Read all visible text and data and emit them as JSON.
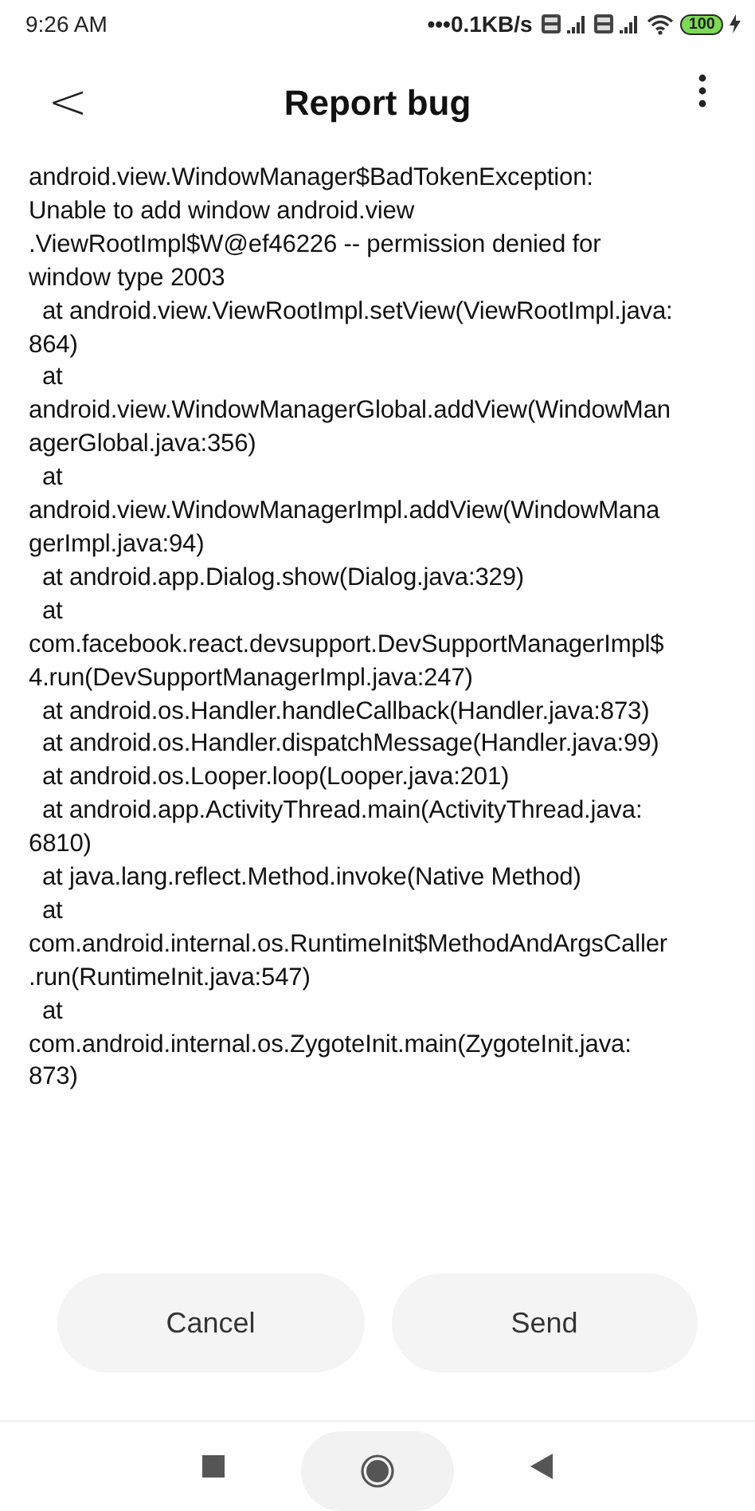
{
  "status_bar": {
    "time": "9:26 AM",
    "network_speed": "•••0.1KB/s",
    "battery": "100",
    "charging": true
  },
  "header": {
    "back": "<",
    "title": "Report bug"
  },
  "message_lines": [
    "android.view.WindowManager$BadTokenException:",
    "Unable to add window android.view",
    ".ViewRootImpl$W@ef46226 -- permission denied for",
    "window type 2003",
    "  at android.view.ViewRootImpl.setView(ViewRootImpl.java:",
    "864)",
    "  at",
    "android.view.WindowManagerGlobal.addView(WindowMan",
    "agerGlobal.java:356)",
    "  at",
    "android.view.WindowManagerImpl.addView(WindowMana",
    "gerImpl.java:94)",
    "  at android.app.Dialog.show(Dialog.java:329)",
    "  at",
    "com.facebook.react.devsupport.DevSupportManagerImpl$",
    "4.run(DevSupportManagerImpl.java:247)",
    "  at android.os.Handler.handleCallback(Handler.java:873)",
    "  at android.os.Handler.dispatchMessage(Handler.java:99)",
    "  at android.os.Looper.loop(Looper.java:201)",
    "  at android.app.ActivityThread.main(ActivityThread.java:",
    "6810)",
    "  at java.lang.reflect.Method.invoke(Native Method)",
    "  at",
    "com.android.internal.os.RuntimeInit$MethodAndArgsCaller",
    ".run(RuntimeInit.java:547)",
    "  at",
    "com.android.internal.os.ZygoteInit.main(ZygoteInit.java:",
    "873)"
  ],
  "buttons": [
    {
      "label": "Cancel"
    },
    {
      "label": "Send"
    }
  ]
}
